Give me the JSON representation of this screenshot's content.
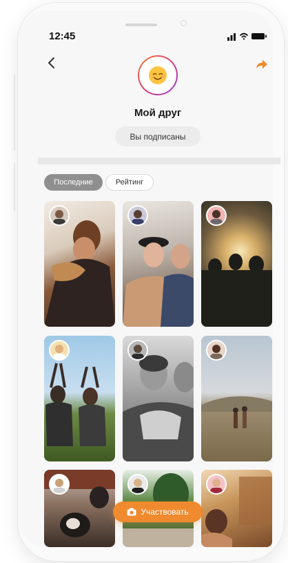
{
  "status_bar": {
    "time": "12:45",
    "icons": [
      "signal-icon",
      "wifi-icon",
      "battery-icon"
    ]
  },
  "header": {
    "back_icon": "chevron-left-icon",
    "share_icon": "share-arrow-icon",
    "avatar_icon": "smiling-face-icon",
    "title": "Мой друг",
    "subscribe_label": "Вы подписаны"
  },
  "tabs": [
    {
      "label": "Последние",
      "active": true
    },
    {
      "label": "Рейтинг",
      "active": false
    }
  ],
  "grid": {
    "items": [
      {
        "scene": "man-with-cat"
      },
      {
        "scene": "women-laughing"
      },
      {
        "scene": "crowd-at-sunset"
      },
      {
        "scene": "friends-hand-hearts"
      },
      {
        "scene": "boys-hugging"
      },
      {
        "scene": "friends-walking-field"
      },
      {
        "scene": "person-with-dog"
      },
      {
        "scene": "trees-outdoors"
      },
      {
        "scene": "woman-indoors"
      }
    ]
  },
  "cta": {
    "label": "Участвовать",
    "icon": "camera-icon"
  },
  "colors": {
    "accent": "#F08A2E",
    "chip_active": "#8F8F8F",
    "screen_bg": "#F7F7F7"
  }
}
